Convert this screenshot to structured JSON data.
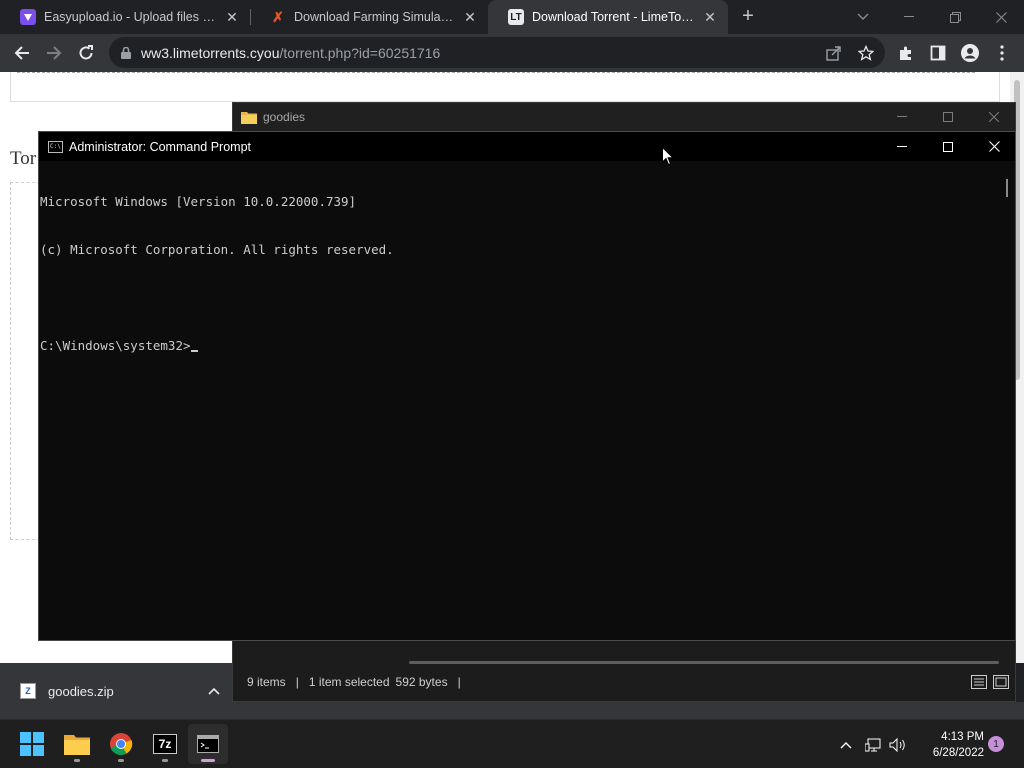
{
  "browser": {
    "tabs": [
      {
        "title": "Easyupload.io - Upload files for f",
        "favicon": "easyupload-icon",
        "active": false
      },
      {
        "title": "Download Farming Simulator 22",
        "favicon": "x-site-icon",
        "active": false
      },
      {
        "title": "Download Torrent - LimeTorrents",
        "favicon": "LT",
        "active": true
      }
    ],
    "url_host": "ww3.limetorrents.cyou",
    "url_path": "/torrent.php?id=60251716"
  },
  "webpage": {
    "heading": "Tor"
  },
  "explorer": {
    "title": "goodies",
    "status": {
      "items": "9 items",
      "selected": "1 item selected",
      "size": "592 bytes"
    }
  },
  "cmd": {
    "title": "Administrator: Command Prompt",
    "icon_text": "C:\\",
    "lines": [
      "Microsoft Windows [Version 10.0.22000.739]",
      "(c) Microsoft Corporation. All rights reserved.",
      "",
      "C:\\Windows\\system32>"
    ]
  },
  "download": {
    "filename": "goodies.zip",
    "icon_text": "Z"
  },
  "taskbar": {
    "apps": [
      "windows-start",
      "file-explorer",
      "chrome",
      "7-zip",
      "command-prompt"
    ],
    "seven_zip_label": "7z",
    "time": "4:13 PM",
    "date": "6/28/2022",
    "notification_count": "1"
  },
  "colors": {
    "accent_purple": "#d79be0",
    "chrome_dark": "#202124",
    "chrome_toolbar": "#35363a",
    "cmd_bg": "#0c0c0c"
  }
}
